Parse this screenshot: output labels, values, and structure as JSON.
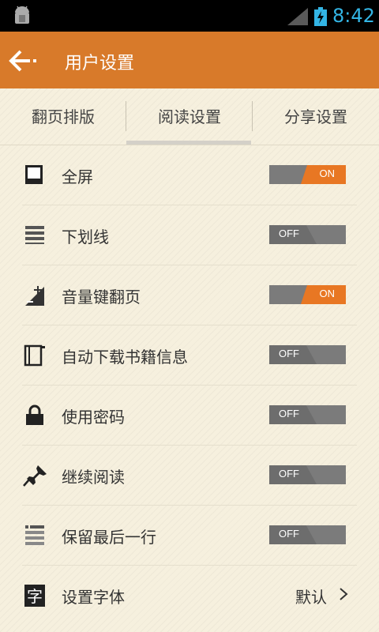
{
  "status_bar": {
    "time": "8:42",
    "icons": [
      "android-debug-icon",
      "signal-icon",
      "battery-charging-icon"
    ]
  },
  "app_bar": {
    "title": "用户设置",
    "back_icon": "back-arrow-icon"
  },
  "tabs": [
    {
      "label": "翻页排版",
      "selected": false
    },
    {
      "label": "阅读设置",
      "selected": true
    },
    {
      "label": "分享设置",
      "selected": false
    }
  ],
  "settings": [
    {
      "label": "全屏",
      "icon": "fullscreen-icon",
      "toggle": "ON"
    },
    {
      "label": "下划线",
      "icon": "underline-icon",
      "toggle": "OFF"
    },
    {
      "label": "音量键翻页",
      "icon": "volume-key-icon",
      "toggle": "ON"
    },
    {
      "label": "自动下载书籍信息",
      "icon": "book-info-icon",
      "toggle": "OFF"
    },
    {
      "label": "使用密码",
      "icon": "lock-icon",
      "toggle": "OFF"
    },
    {
      "label": "继续阅读",
      "icon": "pin-icon",
      "toggle": "OFF"
    },
    {
      "label": "保留最后一行",
      "icon": "keep-last-line-icon",
      "toggle": "OFF"
    },
    {
      "label": "设置字体",
      "icon": "font-icon",
      "value": "默认"
    }
  ],
  "colors": {
    "accent": "#d87a2a",
    "toggle_on": "#e87723",
    "toggle_off": "#7b7b7b",
    "status_time": "#33b5e5"
  }
}
